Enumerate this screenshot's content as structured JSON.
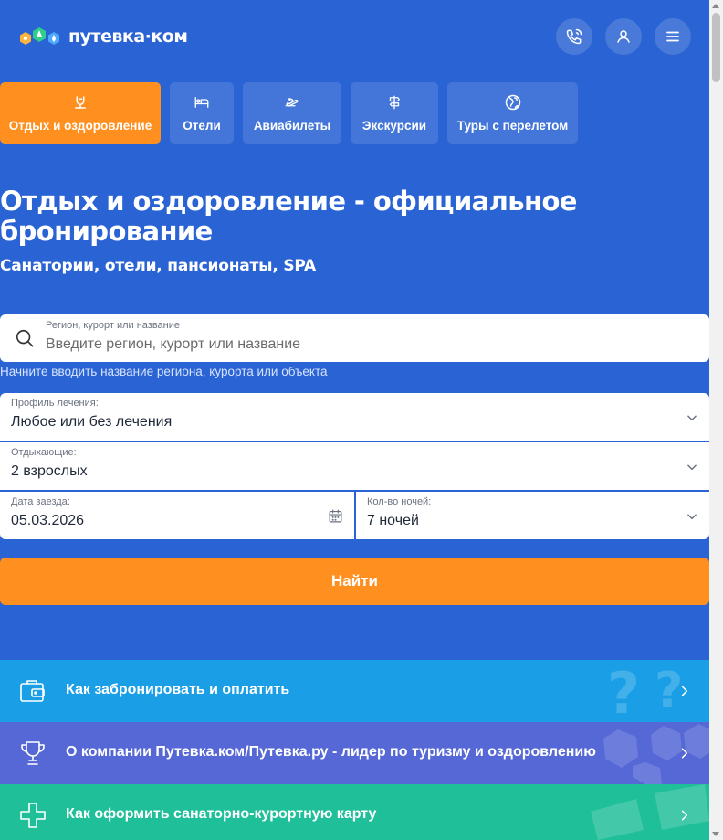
{
  "header": {
    "logo_text": "путевка·ком",
    "phone_button": "phone-icon",
    "profile_button": "user-icon",
    "menu_button": "menu-icon"
  },
  "tabs": [
    {
      "label": "Отдых и оздоровление",
      "icon": "hotel-bell-icon",
      "active": true
    },
    {
      "label": "Отели",
      "icon": "bed-icon",
      "active": false
    },
    {
      "label": "Авиабилеты",
      "icon": "plane-icon",
      "active": false
    },
    {
      "label": "Экскурсии",
      "icon": "signpost-icon",
      "active": false
    },
    {
      "label": "Туры с перелетом",
      "icon": "globe-icon",
      "active": false
    }
  ],
  "hero": {
    "title": "Отдых и оздоровление - официальное бронирование",
    "subtitle": "Санатории, отели, пансионаты, SPA"
  },
  "search": {
    "label": "Регион, курорт или название",
    "placeholder": "Введите регион, курорт или название",
    "hint": "Начните вводить название региона, курорта или объекта"
  },
  "form": {
    "treatment": {
      "label": "Профиль лечения:",
      "value": "Любое или без лечения"
    },
    "guests": {
      "label": "Отдыхающие:",
      "value": "2 взрослых"
    },
    "checkin": {
      "label": "Дата заезда:",
      "value": "05.03.2026"
    },
    "nights": {
      "label": "Кол-во ночей:",
      "value": "7 ночей"
    },
    "submit_label": "Найти"
  },
  "info_rows": [
    {
      "label": "Как забронировать и оплатить",
      "icon": "wallet-icon",
      "color": "#1a9fe6"
    },
    {
      "label": "О компании Путевка.ком/Путевка.ру - лидер по туризму и оздоровлению",
      "icon": "trophy-icon",
      "color": "#5568d6"
    },
    {
      "label": "Как оформить санаторно-курортную карту",
      "icon": "medical-cross-icon",
      "color": "#1fbf9a"
    }
  ],
  "colors": {
    "background": "#2a63d3",
    "accent": "#ff8f1f"
  }
}
